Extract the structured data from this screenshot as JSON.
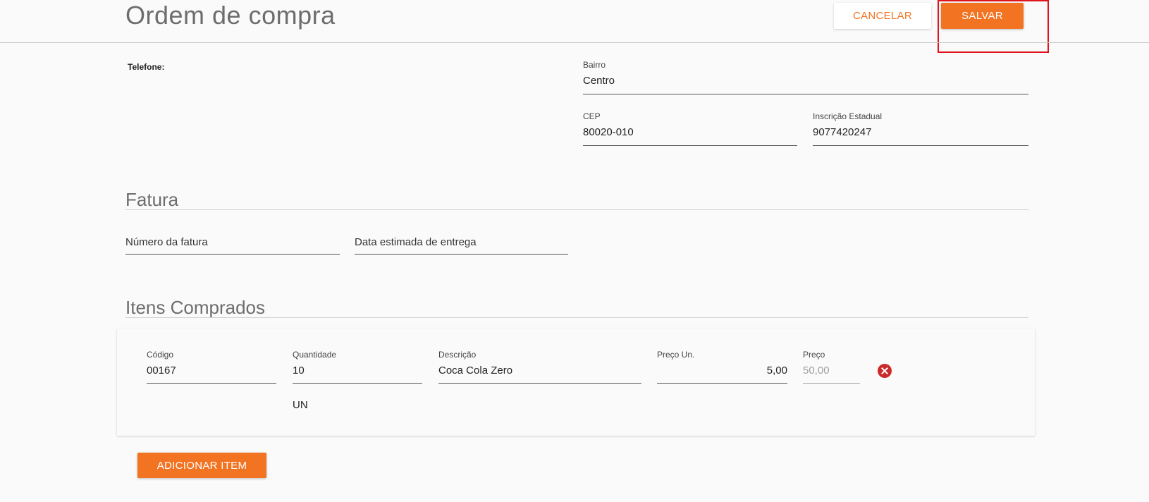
{
  "header": {
    "title": "Ordem de compra",
    "cancel_label": "CANCELAR",
    "save_label": "SALVAR"
  },
  "address": {
    "telefone_label": "Telefone:",
    "bairro": {
      "label": "Bairro",
      "value": "Centro"
    },
    "cep": {
      "label": "CEP",
      "value": "80020-010"
    },
    "inscricao_estadual": {
      "label": "Inscrição Estadual",
      "value": "9077420247"
    }
  },
  "fatura": {
    "title": "Fatura",
    "numero_placeholder": "Número da fatura",
    "data_placeholder": "Data estimada de entrega"
  },
  "itens": {
    "title": "Itens Comprados",
    "rows": [
      {
        "codigo": {
          "label": "Código",
          "value": "00167"
        },
        "quantidade": {
          "label": "Quantidade",
          "value": "10"
        },
        "descricao": {
          "label": "Descrição",
          "value": "Coca Cola Zero"
        },
        "preco_un": {
          "label": "Preço Un.",
          "value": "5,00"
        },
        "preco": {
          "label": "Preço",
          "value": "50,00"
        },
        "unidade": "UN"
      }
    ],
    "add_label": "ADICIONAR ITEM"
  },
  "colors": {
    "accent": "#f27321",
    "remove": "#cc2b2b",
    "highlight": "#e0141c"
  },
  "icons": {
    "remove": "remove-circle-icon"
  }
}
